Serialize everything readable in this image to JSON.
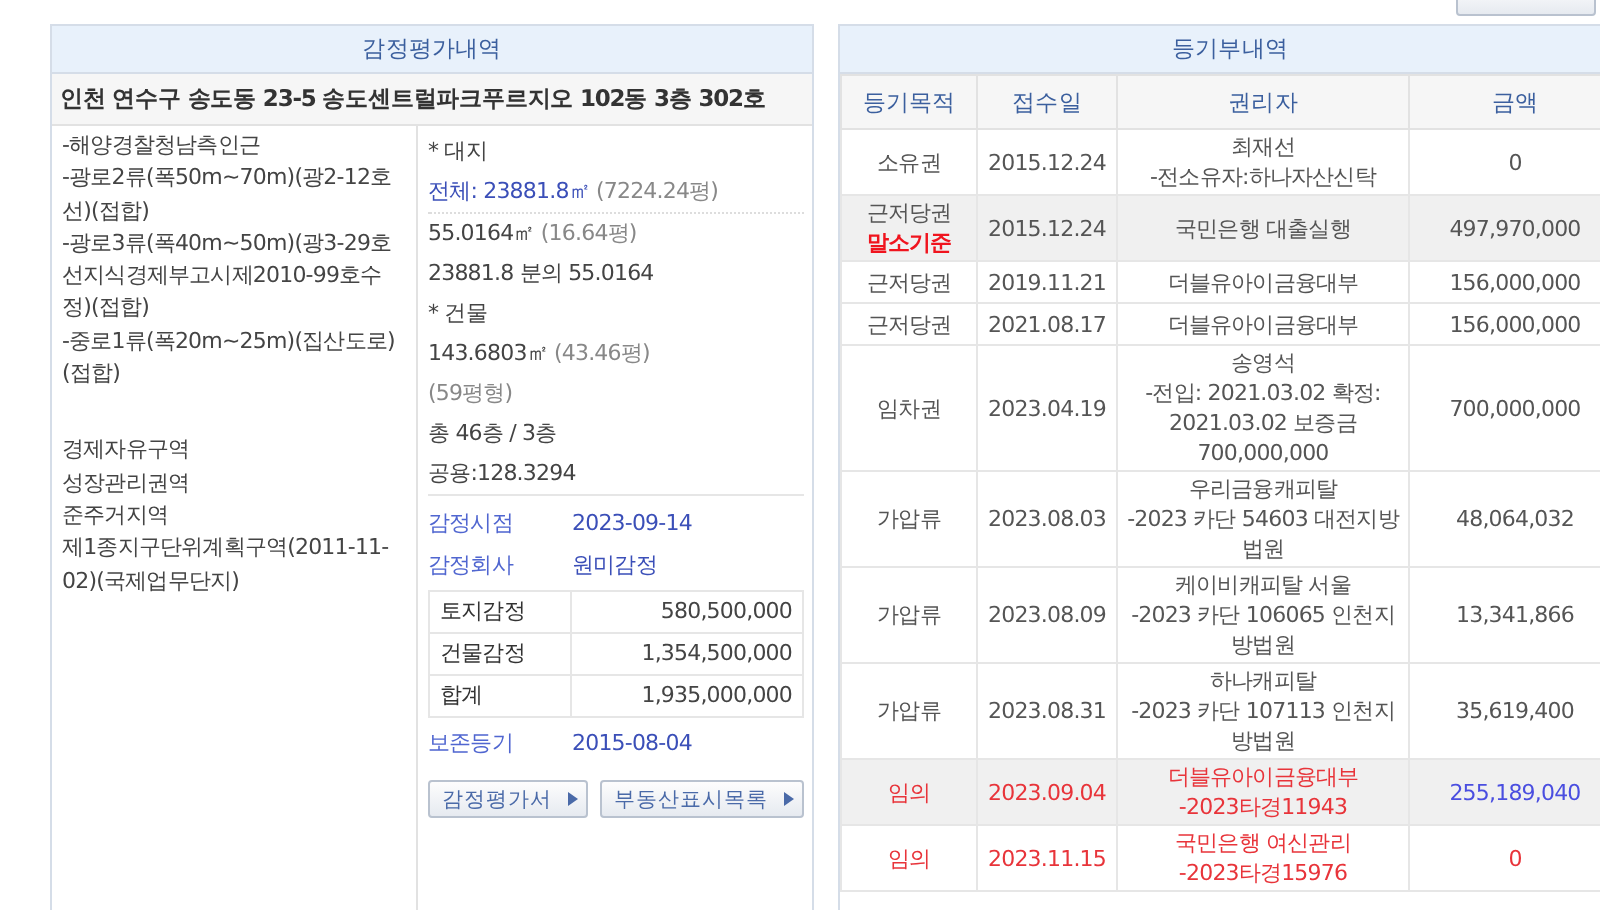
{
  "appraisal": {
    "title": "감정평가내역",
    "address": "인천 연수구 송도동 23-5 송도센트럴파크푸르지오 102동 3층 302호",
    "road_notes": [
      "-해양경찰청남측인근",
      "-광로2류(폭50m~70m)(광2-12호선)(접합)",
      "-광로3류(폭40m~50m)(광3-29호선지식경제부고시제2010-99호수정)(접합)",
      "-중로1류(폭20m~25m)(집산도로)(접합)"
    ],
    "zones": [
      "경제자유구역",
      "성장관리권역",
      "준주거지역",
      "제1종지구단위계획구역(2011-11-02)(국제업무단지)"
    ],
    "land": {
      "heading": "* 대지",
      "total": "전체: 23881.8㎡",
      "total_pyeong": "(7224.24평)",
      "area": "55.0164㎡",
      "area_pyeong": "(16.64평)",
      "share": "23881.8 분의 55.0164"
    },
    "building": {
      "heading": "* 건물",
      "area": "143.6803㎡",
      "area_pyeong": "(43.46평)",
      "size_class": "(59평형)",
      "floors": "총 46층 / 3층",
      "common": "공용:128.3294"
    },
    "info": [
      {
        "label": "감정시점",
        "value": "2023-09-14"
      },
      {
        "label": "감정회사",
        "value": "원미감정"
      }
    ],
    "amounts": [
      {
        "label": "토지감정",
        "value": "580,500,000"
      },
      {
        "label": "건물감정",
        "value": "1,354,500,000"
      },
      {
        "label": "합계",
        "value": "1,935,000,000"
      }
    ],
    "preservation": {
      "label": "보존등기",
      "value": "2015-08-04"
    },
    "buttons": [
      "감정평가서",
      "부동산표시목록"
    ]
  },
  "registry": {
    "title": "등기부내역",
    "columns": [
      "등기목적",
      "접수일",
      "권리자",
      "금액"
    ],
    "rows": [
      {
        "kind": "normal",
        "shaded": false,
        "purpose": "소유권",
        "date": "2015.12.24",
        "holder": [
          "최재선",
          "-전소유자:하나자산신탁"
        ],
        "amount": "0",
        "amount_link": false
      },
      {
        "kind": "normal",
        "shaded": true,
        "purpose": "근저당권",
        "note": "말소기준",
        "date": "2015.12.24",
        "holder": [
          "국민은행 대출실행"
        ],
        "amount": "497,970,000",
        "amount_link": false
      },
      {
        "kind": "normal",
        "shaded": false,
        "purpose": "근저당권",
        "date": "2019.11.21",
        "holder": [
          "더블유아이금융대부"
        ],
        "amount": "156,000,000",
        "amount_link": false
      },
      {
        "kind": "normal",
        "shaded": false,
        "purpose": "근저당권",
        "date": "2021.08.17",
        "holder": [
          "더블유아이금융대부"
        ],
        "amount": "156,000,000",
        "amount_link": false
      },
      {
        "kind": "normal",
        "shaded": false,
        "purpose": "임차권",
        "date": "2023.04.19",
        "holder": [
          "송영석",
          "-전입: 2021.03.02 확정: 2021.03.02 보증금 700,000,000"
        ],
        "amount": "700,000,000",
        "amount_link": false
      },
      {
        "kind": "normal",
        "shaded": false,
        "purpose": "가압류",
        "date": "2023.08.03",
        "holder": [
          "우리금융캐피탈",
          "-2023 카단 54603 대전지방법원"
        ],
        "amount": "48,064,032",
        "amount_link": false
      },
      {
        "kind": "normal",
        "shaded": false,
        "purpose": "가압류",
        "date": "2023.08.09",
        "holder": [
          "케이비캐피탈 서울",
          "-2023 카단 106065 인천지방법원"
        ],
        "amount": "13,341,866",
        "amount_link": false
      },
      {
        "kind": "normal",
        "shaded": false,
        "purpose": "가압류",
        "date": "2023.08.31",
        "holder": [
          "하나캐피탈",
          "-2023 카단 107113 인천지방법원"
        ],
        "amount": "35,619,400",
        "amount_link": false
      },
      {
        "kind": "auction",
        "shaded": true,
        "purpose": "임의",
        "date": "2023.09.04",
        "holder": [
          "더블유아이금융대부",
          "-2023타경11943"
        ],
        "amount": "255,189,040",
        "amount_link": true
      },
      {
        "kind": "auction",
        "shaded": false,
        "purpose": "임의",
        "date": "2023.11.15",
        "holder": [
          "국민은행 여신관리",
          "-2023타경15976"
        ],
        "amount": "0",
        "amount_link": false
      }
    ]
  }
}
